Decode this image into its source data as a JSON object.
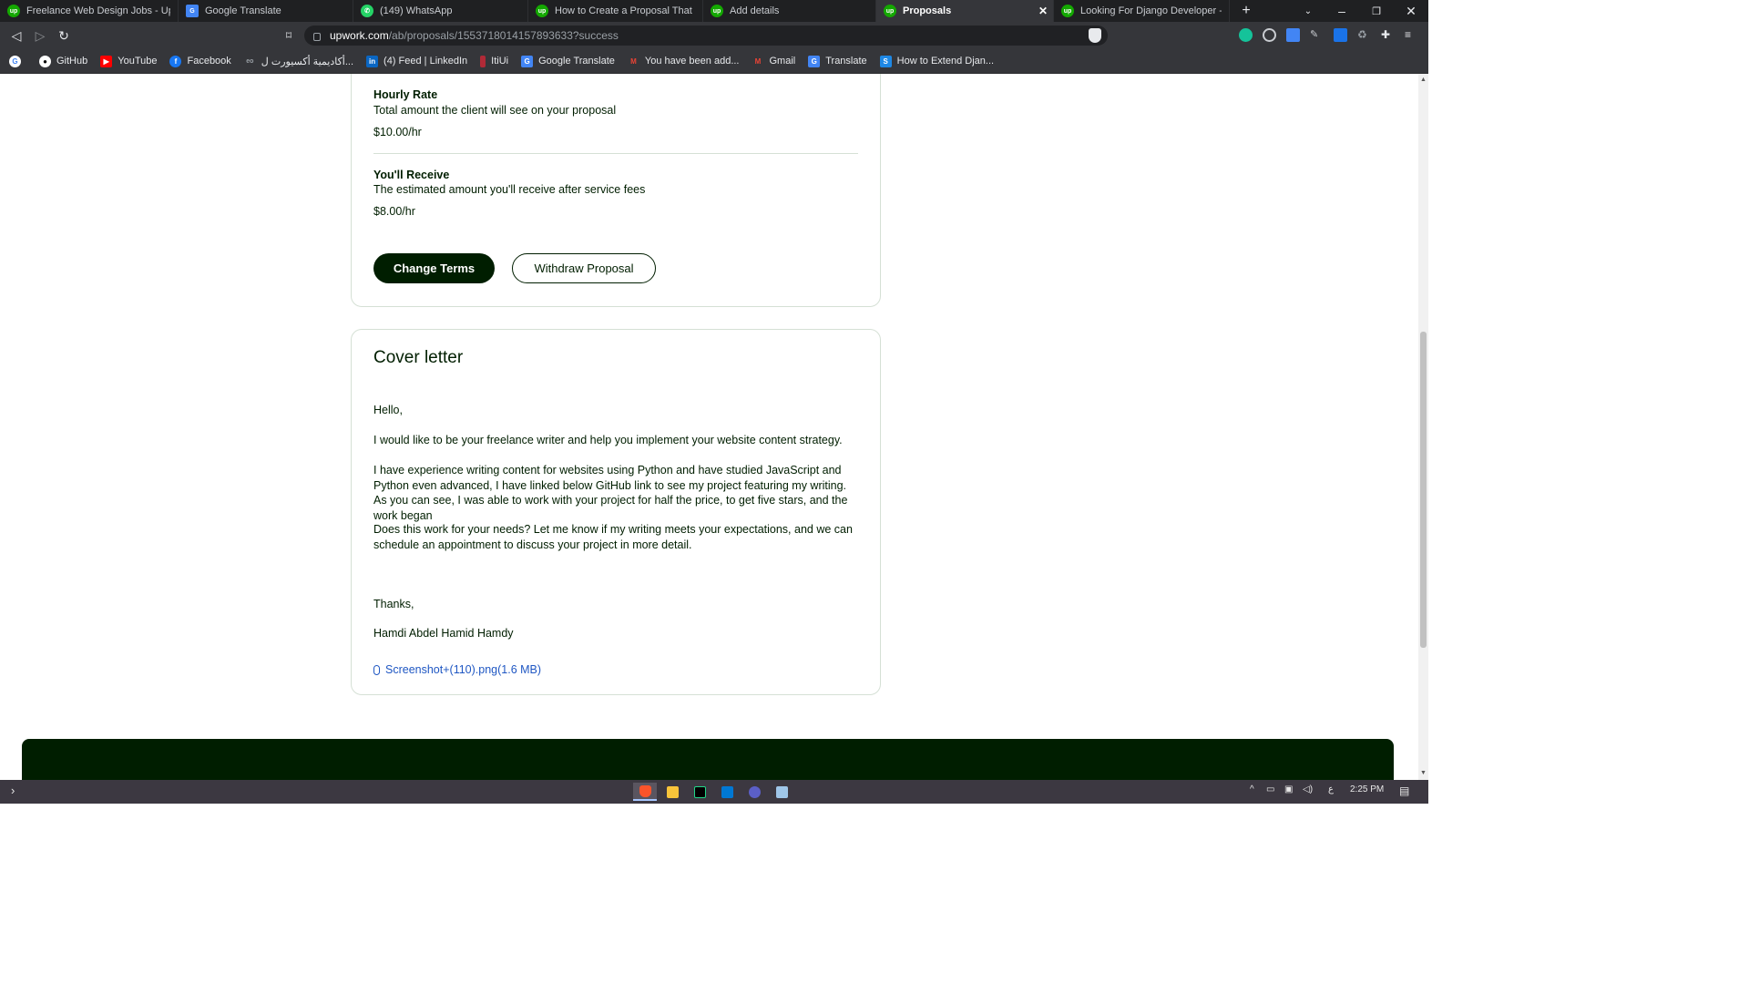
{
  "browser": {
    "tabs": [
      {
        "title": "Freelance Web Design Jobs - Upwork",
        "icon": "upwork-icon",
        "active": false
      },
      {
        "title": "Google Translate",
        "icon": "google-translate-icon",
        "active": false
      },
      {
        "title": "(149) WhatsApp",
        "icon": "whatsapp-icon",
        "active": false
      },
      {
        "title": "How to Create a Proposal That Wins",
        "icon": "upwork-icon",
        "active": false
      },
      {
        "title": "Add details",
        "icon": "upwork-icon",
        "active": false
      },
      {
        "title": "Proposals",
        "icon": "upwork-icon",
        "active": true
      },
      {
        "title": "Looking For Django Developer - Web",
        "icon": "upwork-icon",
        "active": false
      }
    ],
    "address": {
      "host": "upwork.com",
      "path": "/ab/proposals/1553718014157893633?success"
    },
    "bookmarks": [
      {
        "label": "GitHub",
        "icon": "github-icon"
      },
      {
        "label": "YouTube",
        "icon": "youtube-icon"
      },
      {
        "label": "Facebook",
        "icon": "facebook-icon"
      },
      {
        "label": "أكاديمية أكسيورت ل...",
        "icon": "academy-icon"
      },
      {
        "label": "(4) Feed | LinkedIn",
        "icon": "linkedin-icon"
      },
      {
        "label": "ItiUi",
        "icon": "bookmark-icon"
      },
      {
        "label": "Google Translate",
        "icon": "google-translate-icon"
      },
      {
        "label": "You have been add...",
        "icon": "gmail-icon"
      },
      {
        "label": "Gmail",
        "icon": "gmail-icon"
      },
      {
        "label": "Translate",
        "icon": "google-translate-icon"
      },
      {
        "label": "How to Extend Djan...",
        "icon": "stackoverflow-icon"
      }
    ]
  },
  "terms": {
    "hourly_rate": {
      "title": "Hourly Rate",
      "description": "Total amount the client will see on your proposal",
      "value": "$10.00/hr"
    },
    "receive": {
      "title": "You'll Receive",
      "description": "The estimated amount you'll receive after service fees",
      "value": "$8.00/hr"
    },
    "change_terms_label": "Change Terms",
    "withdraw_label": "Withdraw Proposal"
  },
  "cover_letter": {
    "title": "Cover letter",
    "paragraphs": [
      "Hello,",
      "I would like to be your freelance writer and help you implement your website content strategy.",
      "I have experience writing content for websites using Python and have studied JavaScript and Python even advanced, I have linked below GitHub link to see my project featuring my writing. As you can see, I was able to work with your project for half the price, to get five stars, and the work began",
      "Does this work for your needs? Let me know if my writing meets your expectations, and we can schedule an appointment to discuss your project in more detail.",
      "Thanks,",
      "Hamdi Abdel Hamid Hamdy"
    ],
    "attachment": "Screenshot+(110).png(1.6 MB)"
  },
  "taskbar": {
    "time": "2:25 PM",
    "lang": "ع"
  },
  "colors": {
    "brand_dark": "#001e00",
    "upwork_green": "#14a800",
    "link_blue": "#1f57c3"
  }
}
